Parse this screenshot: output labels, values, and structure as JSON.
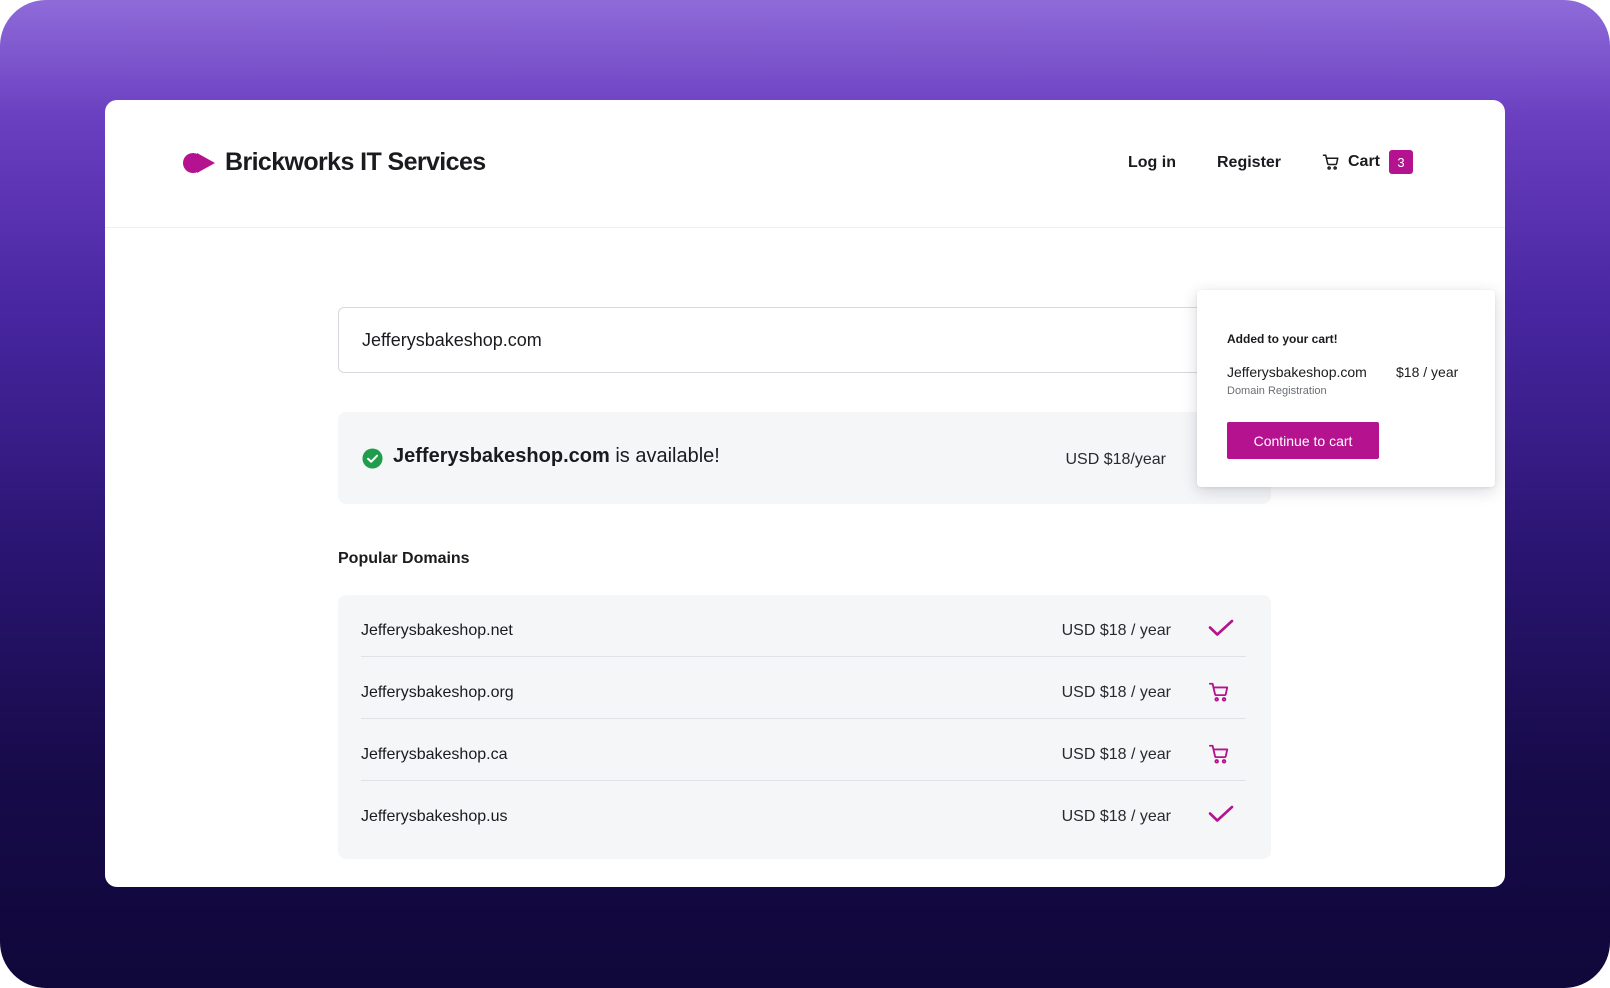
{
  "colors": {
    "accent": "#b5128f",
    "success": "#1f9d4a",
    "card_bg": "#f5f6f8"
  },
  "brand": {
    "name": "Brickworks IT Services",
    "logo_icon": "logo-mark-icon"
  },
  "nav": {
    "login_label": "Log in",
    "register_label": "Register",
    "cart_label": "Cart",
    "cart_count": "3",
    "cart_icon": "cart-icon"
  },
  "search": {
    "value": "Jefferysbakeshop.com"
  },
  "availability": {
    "domain": "Jefferysbakeshop.com",
    "message": " is available!",
    "price": "USD $18/year",
    "status_icon": "check-circle-icon",
    "action_icon": "checkmark-icon"
  },
  "popular": {
    "title": "Popular Domains",
    "items": [
      {
        "domain": "Jefferysbakeshop.net",
        "price": "USD $18 / year",
        "action_icon": "checkmark-icon"
      },
      {
        "domain": "Jefferysbakeshop.org",
        "price": "USD $18 / year",
        "action_icon": "add-to-cart-icon"
      },
      {
        "domain": "Jefferysbakeshop.ca",
        "price": "USD $18 / year",
        "action_icon": "add-to-cart-icon"
      },
      {
        "domain": "Jefferysbakeshop.us",
        "price": "USD $18 / year",
        "action_icon": "checkmark-icon"
      }
    ]
  },
  "cart_popover": {
    "title": "Added to your cart!",
    "item_domain": "Jefferysbakeshop.com",
    "item_price": "$18 / year",
    "item_type": "Domain Registration",
    "button_label": "Continue to cart"
  }
}
